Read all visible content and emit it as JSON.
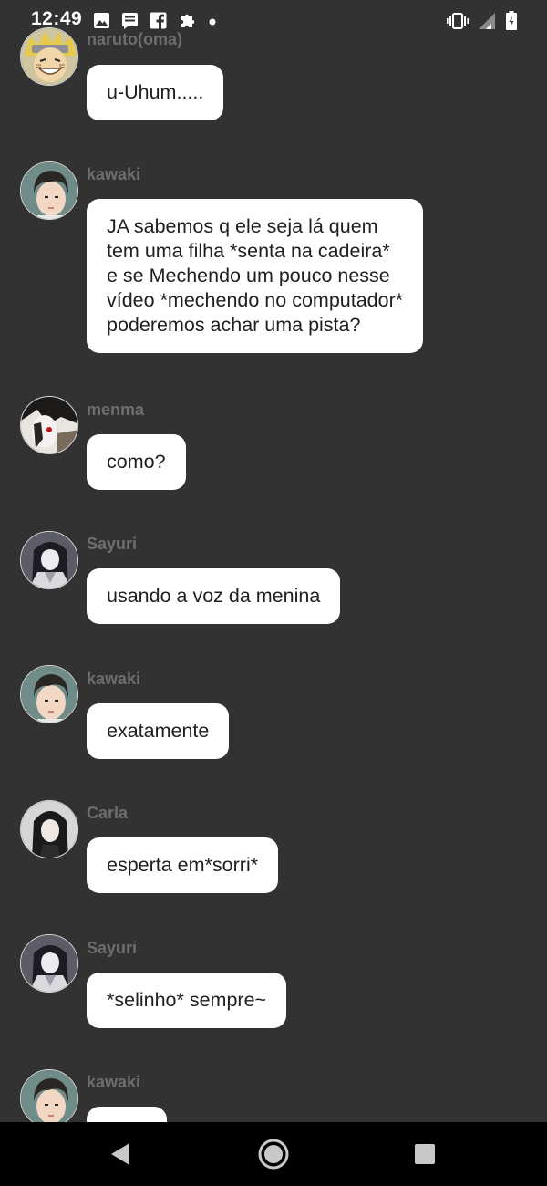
{
  "status_bar": {
    "time": "12:49",
    "left_icons": [
      "image-icon",
      "message-icon",
      "facebook-icon",
      "puzzle-icon",
      "dot-icon"
    ],
    "right_icons": [
      "vibrate-icon",
      "signal-icon",
      "battery-icon"
    ]
  },
  "messages": [
    {
      "author": "naruto(oma)",
      "text": "u-Uhum.....",
      "avatar": "naruto-avatar"
    },
    {
      "author": "kawaki",
      "text": "JA sabemos q ele seja lá quem\ntem uma filha *senta na cadeira*\ne se Mechendo um pouco nesse\nvídeo *mechendo no computador*\npoderemos achar uma pista?",
      "avatar": "kawaki-avatar"
    },
    {
      "author": "menma",
      "text": "como?",
      "avatar": "menma-avatar"
    },
    {
      "author": "Sayuri",
      "text": "usando a voz da menina",
      "avatar": "sayuri-avatar"
    },
    {
      "author": "kawaki",
      "text": "exatamente",
      "avatar": "kawaki-avatar"
    },
    {
      "author": "Carla",
      "text": "esperta em*sorri*",
      "avatar": "carla-avatar"
    },
    {
      "author": "Sayuri",
      "text": "*selinho* sempre~",
      "avatar": "sayuri-avatar"
    },
    {
      "author": "kawaki",
      "text": "",
      "avatar": "kawaki-avatar"
    }
  ],
  "nav_bar": {
    "buttons": [
      "back-icon",
      "home-icon",
      "recents-icon"
    ]
  },
  "colors": {
    "background": "#323232",
    "bubble": "#ffffff",
    "author_text": "#6e6e6e",
    "nav_bar": "#000000"
  }
}
